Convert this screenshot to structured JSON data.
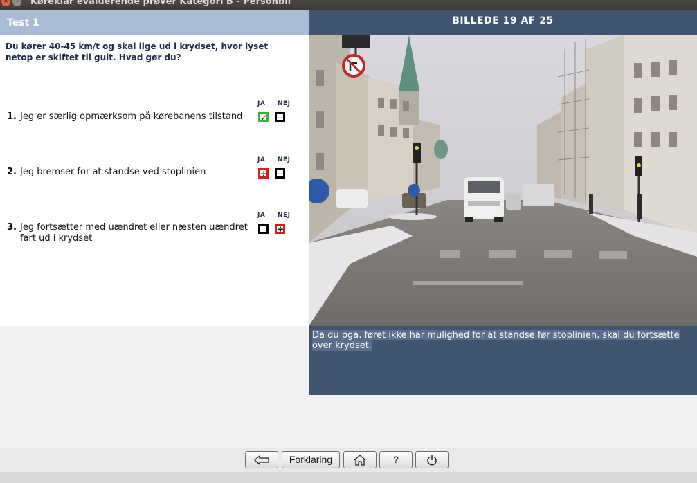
{
  "window": {
    "title": "Køreklar evaluerende prøver Kategori B - Personbil"
  },
  "left_panel": {
    "header": "Test 1",
    "question": "Du kører 40-45 km/t og skal lige ud i krydset, hvor lyset netop er skiftet til gult. Hvad gør du?",
    "col_yes": "JA",
    "col_no": "NEJ",
    "items": [
      {
        "number": "1.",
        "text": "Jeg er særlig opmærksom på kørebanens tilstand",
        "yes_mark": "✓",
        "no_mark": "",
        "yes_state": "correct-selected",
        "no_state": "empty"
      },
      {
        "number": "2.",
        "text": "Jeg bremser for at standse ved stoplinien",
        "yes_mark": "÷",
        "no_mark": "",
        "yes_state": "wrong-selected",
        "no_state": "empty"
      },
      {
        "number": "3.",
        "text": "Jeg fortsætter med uændret eller næsten uændret fart ud i krydset",
        "yes_mark": "",
        "no_mark": "÷",
        "yes_state": "empty",
        "no_state": "wrong-selected"
      }
    ]
  },
  "right_panel": {
    "header": "BILLEDE 19 AF 25",
    "explanation": "Da du pga. føret ikke har mulighed for at standse før stoplinien, skal du fortsætte over krydset."
  },
  "toolbar": {
    "back_icon": "arrow-left-icon",
    "explain_label": "Forklaring",
    "home_icon": "home-icon",
    "help_label": "?",
    "power_icon": "power-icon"
  },
  "colors": {
    "left_header": "#a9bcd4",
    "right_header": "#415470",
    "correct": "#3bb339",
    "wrong": "#d02020"
  }
}
